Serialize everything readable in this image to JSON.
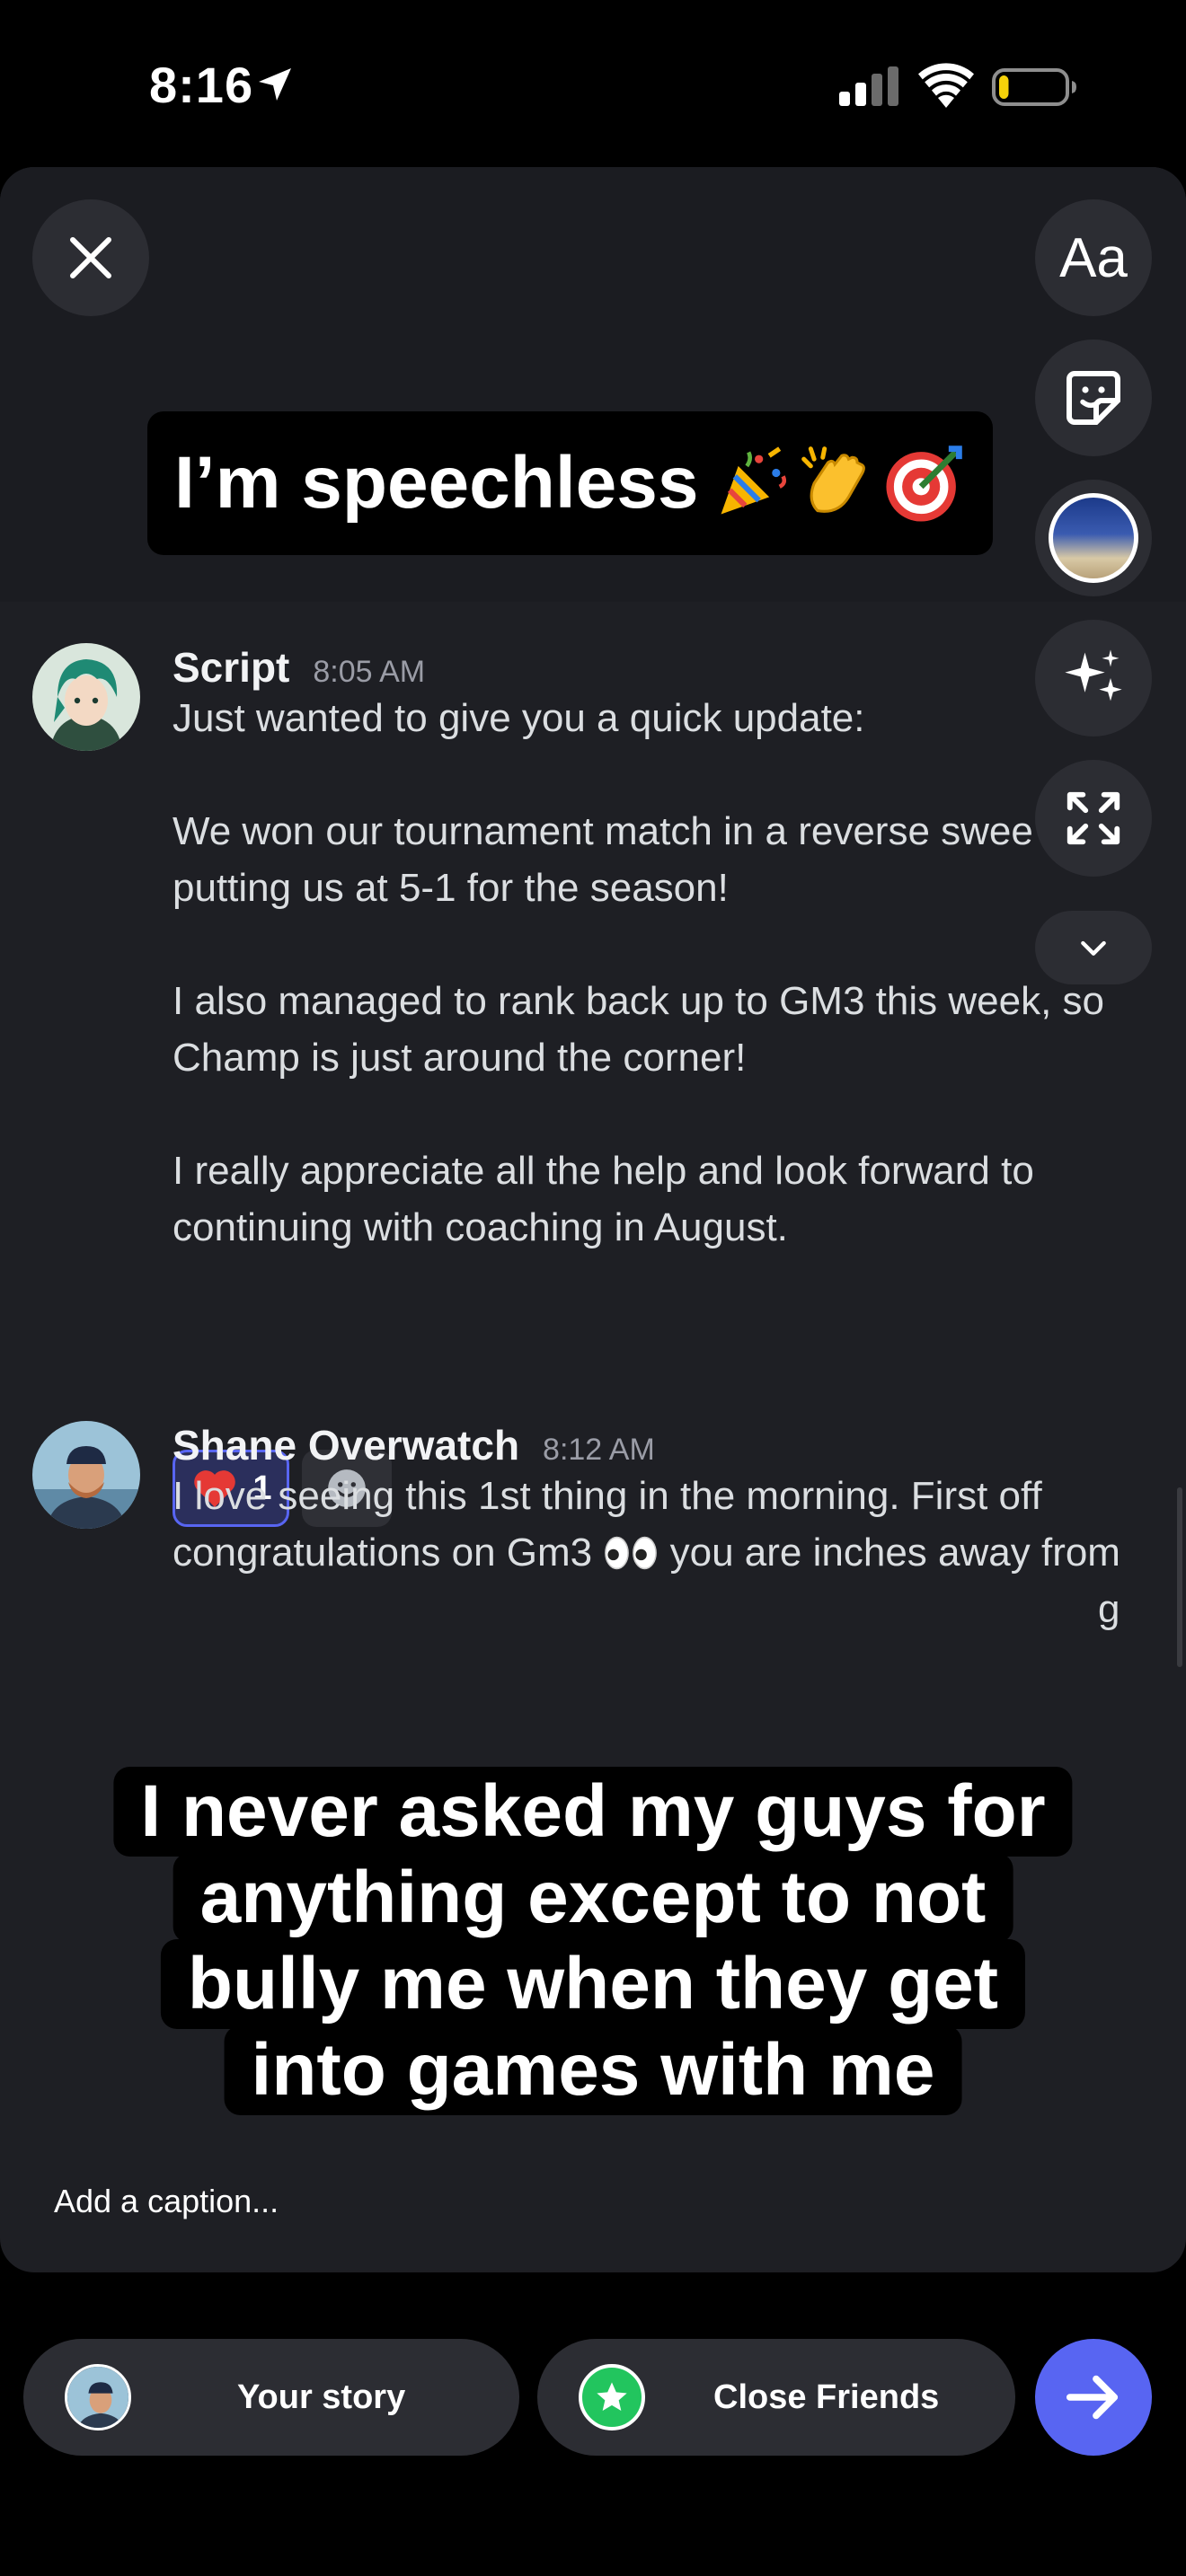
{
  "status_bar": {
    "time": "8:16",
    "location_icon": "location-arrow-icon",
    "signal_icon": "cellular-signal-icon",
    "wifi_icon": "wifi-icon",
    "battery_icon": "battery-low-icon",
    "battery_level_fraction": 0.15
  },
  "tools": {
    "close_icon": "close-icon",
    "text_label": "Aa",
    "sticker_icon": "sticker-icon",
    "thumbnail_icon": "media-thumbnail-icon",
    "effects_icon": "sparkles-icon",
    "resize_icon": "expand-icon",
    "more_icon": "chevron-down-icon"
  },
  "top_caption": {
    "text": "I’m speechless",
    "emojis": [
      "party-popper",
      "clapping-hands",
      "direct-hit"
    ]
  },
  "messages": [
    {
      "author": "Script",
      "time": "8:05 AM",
      "body": "Just wanted to give you a quick update:\n\nWe won our tournament match in a reverse swee\nputting us at 5-1 for the season!\n\nI also managed to rank back up to GM3 this week, so\nChamp is just around the corner!\n\nI really appreciate all the help and look forward to\ncontinuing with coaching in August.",
      "reaction_emoji": "❤️",
      "reaction_count": "1"
    },
    {
      "author": "Shane Overwatch",
      "time": "8:12 AM",
      "body_line1": "I love seeing this 1st thing in the morning. First off",
      "body_line2_start": "congratulations on Gm3",
      "body_line2_end": "you are inches away from",
      "eyes_emoji": "👀",
      "partial_tail": "g"
    }
  ],
  "overlay_caption": {
    "lines": [
      "I never asked my guys for",
      "anything except to not",
      "bully me when they get",
      "into games with me"
    ]
  },
  "caption_placeholder": "Add a caption...",
  "bottom": {
    "story_label": "Your story",
    "friends_label": "Close Friends",
    "send_icon": "arrow-right-icon"
  },
  "colors": {
    "background": "#000000",
    "card": "#1e1f24",
    "button": "#2c2d33",
    "accent": "#5865f2",
    "close_friends": "#22c55e"
  }
}
